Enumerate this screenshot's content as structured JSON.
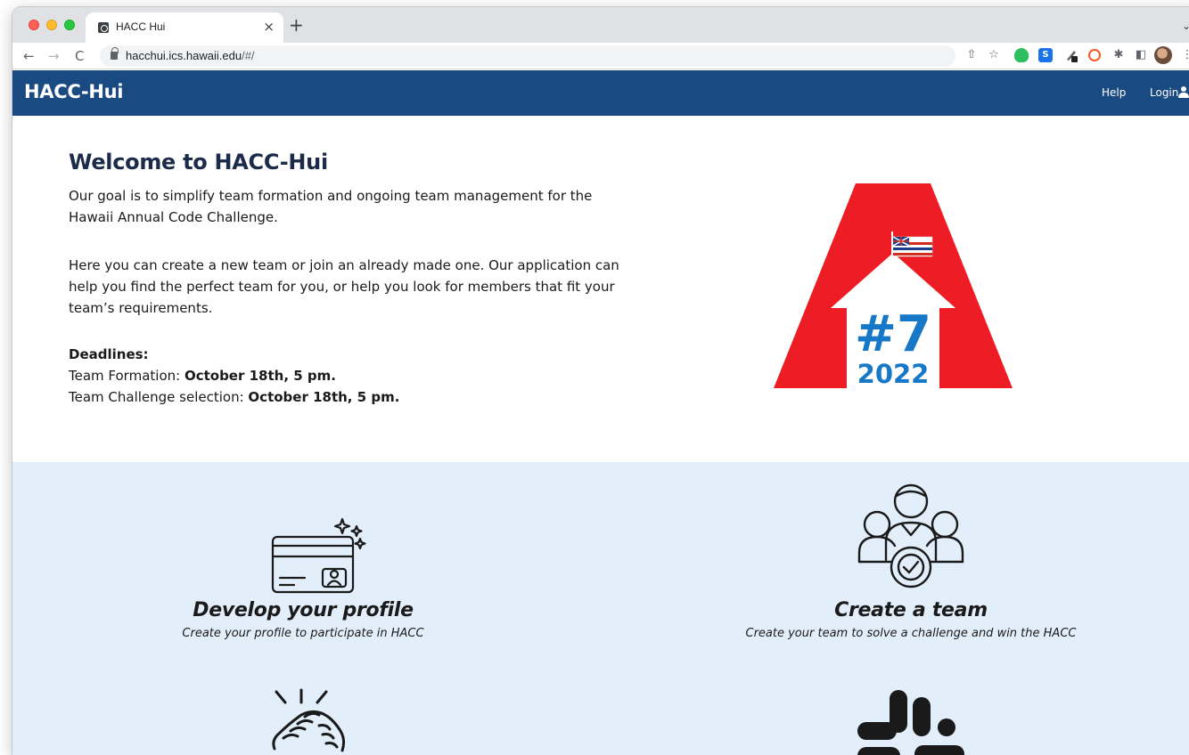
{
  "browser": {
    "tab_title": "HACC Hui",
    "tab_close": "×",
    "new_tab": "+",
    "tab_dropdown": "⌄",
    "url_host": "hacchui.ics.hawaii.edu",
    "url_path": "/#/",
    "nav_back": "←",
    "nav_forward": "→",
    "nav_reload": "C",
    "share": "⇧",
    "bookmark": "☆",
    "ext_blue": "S",
    "ext_puzzle": "✱",
    "sidebar_toggle": "◧",
    "menu": "⋮"
  },
  "site": {
    "brand": "HACC-Hui",
    "nav": {
      "help": "Help",
      "login": "Login"
    }
  },
  "hero": {
    "title": "Welcome to HACC-Hui",
    "paragraph1": "Our goal is to simplify team formation and ongoing team management for the Hawaii Annual Code Challenge.",
    "paragraph2": "Here you can create a new team or join an already made one. Our application can help you find the perfect team for you, or help you look for members that fit your team’s requirements.",
    "deadlines_heading": "Deadlines:",
    "deadline1_label": "Team Formation: ",
    "deadline1_value": "October 18th, 5 pm.",
    "deadline2_label": "Team Challenge selection: ",
    "deadline2_value": "October 18th, 5 pm."
  },
  "logo": {
    "number": "#7",
    "year": "2022",
    "red": "#ee1c24",
    "blue": "#1678c6"
  },
  "features": [
    {
      "title": "Develop your profile",
      "subtitle": "Create your profile to participate in HACC",
      "icon": "profile-card-icon"
    },
    {
      "title": "Create a team",
      "subtitle": "Create your team to solve a challenge and win the HACC",
      "icon": "team-icon"
    },
    {
      "icon": "handshake-icon"
    },
    {
      "icon": "slack-icon"
    }
  ],
  "colors": {
    "navbar": "#1a4a82",
    "features_bg": "#e3eefb"
  }
}
